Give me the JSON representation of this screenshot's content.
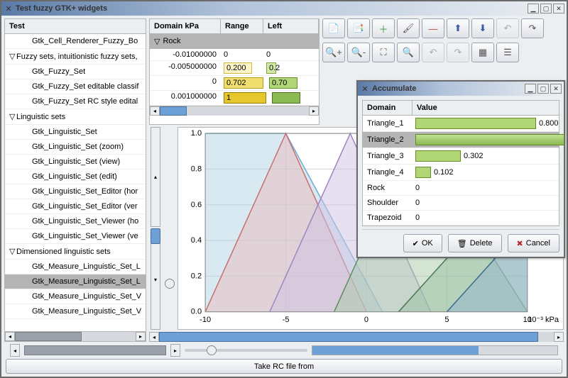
{
  "main_window": {
    "title": "Test fuzzy GTK+ widgets"
  },
  "tree": {
    "header": "Test",
    "items": [
      {
        "label": "Gtk_Cell_Renderer_Fuzzy_Bo",
        "indent": 1,
        "expander": ""
      },
      {
        "label": "Fuzzy sets, intuitionistic fuzzy sets,",
        "indent": 0,
        "expander": "▽"
      },
      {
        "label": "Gtk_Fuzzy_Set",
        "indent": 1,
        "expander": ""
      },
      {
        "label": "Gtk_Fuzzy_Set editable classif",
        "indent": 1,
        "expander": ""
      },
      {
        "label": "Gtk_Fuzzy_Set RC style edital",
        "indent": 1,
        "expander": ""
      },
      {
        "label": "Linguistic sets",
        "indent": 0,
        "expander": "▽"
      },
      {
        "label": "Gtk_Linguistic_Set",
        "indent": 1,
        "expander": ""
      },
      {
        "label": "Gtk_Linguistic_Set (zoom)",
        "indent": 1,
        "expander": ""
      },
      {
        "label": "Gtk_Linguistic_Set (view)",
        "indent": 1,
        "expander": ""
      },
      {
        "label": "Gtk_Linguistic_Set (edit)",
        "indent": 1,
        "expander": ""
      },
      {
        "label": "Gtk_Linguistic_Set_Editor (hor",
        "indent": 1,
        "expander": ""
      },
      {
        "label": "Gtk_Linguistic_Set_Editor (ver",
        "indent": 1,
        "expander": ""
      },
      {
        "label": "Gtk_Linguistic_Set_Viewer (ho",
        "indent": 1,
        "expander": ""
      },
      {
        "label": "Gtk_Linguistic_Set_Viewer (ve",
        "indent": 1,
        "expander": ""
      },
      {
        "label": "Dimensioned linguistic sets",
        "indent": 0,
        "expander": "▽"
      },
      {
        "label": "Gtk_Measure_Linguistic_Set_L",
        "indent": 1,
        "expander": ""
      },
      {
        "label": "Gtk_Measure_Linguistic_Set_L",
        "indent": 1,
        "expander": "",
        "selected": true
      },
      {
        "label": "Gtk_Measure_Linguistic_Set_V",
        "indent": 1,
        "expander": ""
      },
      {
        "label": "Gtk_Measure_Linguistic_Set_V",
        "indent": 1,
        "expander": ""
      }
    ]
  },
  "data_table": {
    "columns": {
      "c1": "Domain kPa",
      "c2": "Range",
      "c3": "Left"
    },
    "rock_label": "Rock",
    "rows": [
      {
        "domain": "-0.01000000",
        "range": "0",
        "left": "0"
      },
      {
        "domain": "-0.005000000",
        "range": "0.200",
        "left": "0.2",
        "range_cls": "y1",
        "left_cls": "g1"
      },
      {
        "domain": "0",
        "range": "0.702",
        "left": "0.70",
        "range_cls": "y2",
        "left_cls": "g2"
      },
      {
        "domain": "0.001000000",
        "range": "1",
        "left": "",
        "range_cls": "y3",
        "left_cls": "g3"
      }
    ]
  },
  "toolbar": {
    "r1": [
      "new",
      "copy",
      "add",
      "paint",
      "remove",
      "up",
      "down",
      "undo",
      "redo"
    ],
    "r2": [
      "zoom-in",
      "zoom-out",
      "zoom-fit",
      "zoom-100",
      "go-prev",
      "go-next",
      "snap",
      "grid"
    ]
  },
  "chart_data": {
    "type": "line",
    "xlabel": "kPa",
    "x_unit_suffix": "10⁻³ kPa",
    "xlim": [
      -10,
      10
    ],
    "ylim": [
      0,
      1.0
    ],
    "xticks": [
      -10,
      -5,
      0,
      5,
      10
    ],
    "yticks": [
      0.0,
      0.2,
      0.4,
      0.6,
      0.8,
      1.0
    ],
    "series": [
      {
        "name": "Triangle_1",
        "color": "#6faed0",
        "fill": "#b4d3e3",
        "points": [
          [
            -10,
            1.0
          ],
          [
            -10,
            1.0
          ],
          [
            -5,
            1.0
          ],
          [
            1,
            0.0
          ]
        ]
      },
      {
        "name": "Triangle_2",
        "color": "#c86f70",
        "fill": "#e8bcbc",
        "points": [
          [
            -10,
            0.0
          ],
          [
            -5,
            1.0
          ],
          [
            0,
            0.0
          ]
        ]
      },
      {
        "name": "Triangle_3",
        "color": "#a084c4",
        "fill": "#d0c2e3",
        "points": [
          [
            -6,
            0.0
          ],
          [
            -1,
            1.0
          ],
          [
            4,
            0.0
          ]
        ]
      },
      {
        "name": "Triangle_4",
        "color": "#5d8c5d",
        "fill": "#a8c9a8",
        "points": [
          [
            -2,
            0.0
          ],
          [
            3,
            1.0
          ],
          [
            10,
            0.0
          ]
        ]
      },
      {
        "name": "Shoulder",
        "color": "#4a7a56",
        "fill": "#9bc0a4",
        "points": [
          [
            2,
            0.0
          ],
          [
            10,
            0.8
          ],
          [
            10,
            0.8
          ]
        ]
      },
      {
        "name": "Trapezoid",
        "color": "#3a6c90",
        "fill": "#8fb4ce",
        "points": [
          [
            5,
            0.0
          ],
          [
            10,
            0.5
          ]
        ]
      }
    ]
  },
  "accumulate": {
    "title": "Accumulate",
    "columns": {
      "domain": "Domain",
      "value": "Value"
    },
    "rows": [
      {
        "name": "Triangle_1",
        "value": "0.800",
        "bar": "b1"
      },
      {
        "name": "Triangle_2",
        "value": "1",
        "bar": "b2",
        "selected": true
      },
      {
        "name": "Triangle_3",
        "value": "0.302",
        "bar": "b3"
      },
      {
        "name": "Triangle_4",
        "value": "0.102",
        "bar": "b4"
      },
      {
        "name": "Rock",
        "value": "0"
      },
      {
        "name": "Shoulder",
        "value": "0"
      },
      {
        "name": "Trapezoid",
        "value": "0"
      }
    ],
    "buttons": {
      "ok": "OK",
      "delete": "Delete",
      "cancel": "Cancel"
    }
  },
  "footer": {
    "take_rc": "Take RC file from"
  }
}
